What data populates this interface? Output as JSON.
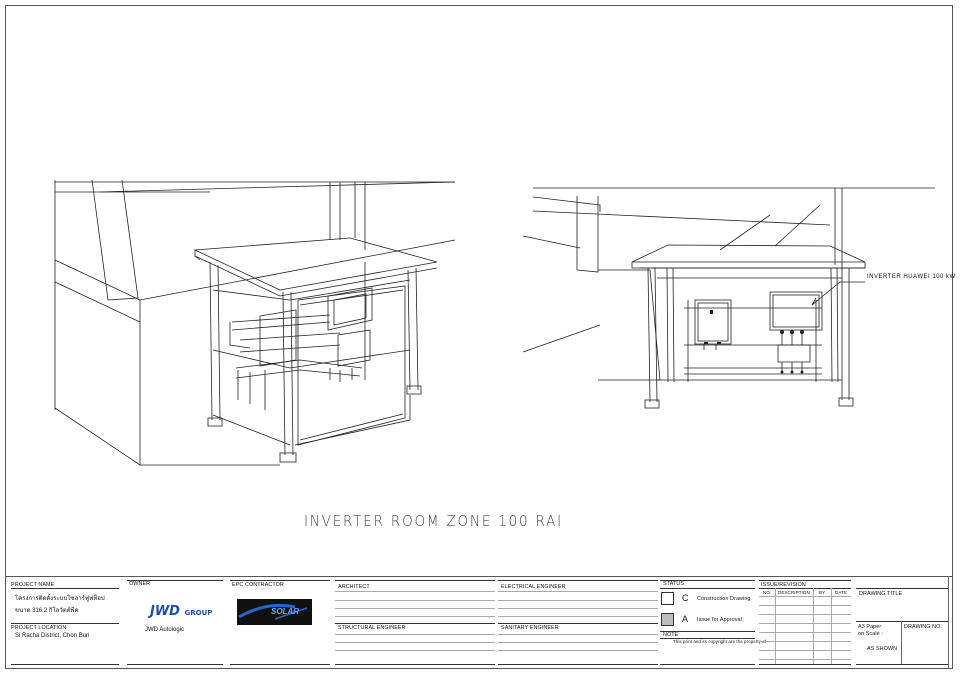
{
  "drawing": {
    "title": "INVERTER ROOM ZONE 100 RAI",
    "callout": "INVERTER HUAWEI 100 kW"
  },
  "title_block": {
    "project_name_label": "PROJECT NAME",
    "project_name_line1": "โครงการติดตั้งระบบโซลาร์ฟูฟท็อป",
    "project_name_line2": "ขนาด 316.2 กิโลวัตต์พีค",
    "project_location_label": "PROJECT LOCATION",
    "project_location": "Si Racha District, Chon Buri",
    "owner_label": "OWNER",
    "owner_logo_text": "JWD",
    "owner_logo_group": "GROUP",
    "owner_name": "JWD Autologic",
    "epc_label": "EPC CONTRACTOR",
    "epc_logo_text": "SOLAR",
    "architect_label": "ARCHITECT",
    "structural_label": "STRUCTURAL ENGINEER",
    "electrical_label": "ELECTRICAL ENGINEER",
    "sanitary_label": "SANITARY ENGINEER",
    "status_label": "STATUS",
    "status_c_letter": "C",
    "status_c_text": "Construction Drawing",
    "status_a_letter": "A",
    "status_a_text": "Issue for Approval",
    "note_label": "NOTE",
    "note_text": "This print and its copyright are the property of",
    "revision_label": "ISSUE/REVISION",
    "rev_cols": [
      "NO.",
      "DESCRIPTION",
      "BY",
      "DATE"
    ],
    "drawing_title_label": "DRAWING TITLE",
    "paper_line1": "A3 Paper",
    "paper_line2": "on Scale :",
    "scale": "AS SHOWN",
    "drawing_no_label": "DRAWING NO."
  },
  "colors": {
    "accent_blue": "#1d4fa8",
    "status_a_fill": "#bdbdbd"
  }
}
